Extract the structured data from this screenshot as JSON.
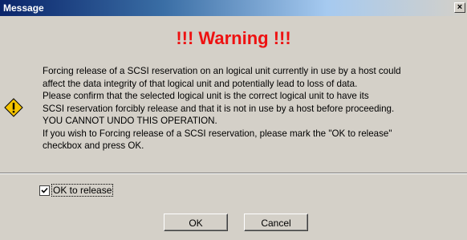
{
  "window": {
    "title": "Message",
    "close_glyph": "×"
  },
  "heading": "!!! Warning !!!",
  "icon": {
    "name": "warning-icon",
    "color": "#f5c400"
  },
  "message_lines": [
    "Forcing release of a SCSI reservation on an logical unit currently in use by a host could",
    "affect the data integrity of that logical unit and potentially lead to loss of data.",
    "Please confirm that the selected logical unit is the correct logical unit to have its",
    "SCSI reservation forcibly release and that it is not in use by a host before proceeding.",
    "YOU CANNOT UNDO THIS OPERATION.",
    "If you wish to Forcing release of a SCSI reservation, please mark the \"OK to release\"",
    "checkbox and press OK."
  ],
  "checkbox": {
    "label": "OK to release",
    "checked": true
  },
  "buttons": {
    "ok": "OK",
    "cancel": "Cancel"
  },
  "colors": {
    "heading": "#ee1111",
    "titlebar": "#0a246a",
    "background": "#d4d0c8"
  }
}
